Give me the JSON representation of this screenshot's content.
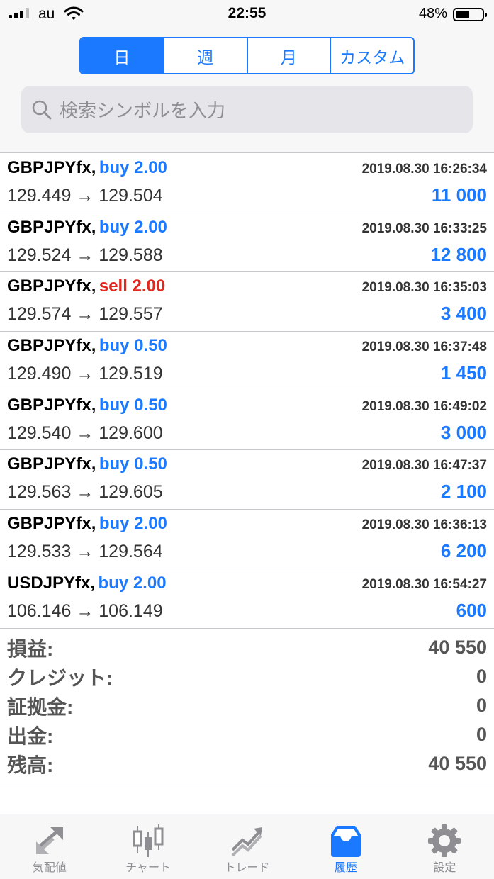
{
  "status_bar": {
    "carrier": "au",
    "time": "22:55",
    "battery": "48%"
  },
  "segments": [
    {
      "label": "日",
      "active": true
    },
    {
      "label": "週",
      "active": false
    },
    {
      "label": "月",
      "active": false
    },
    {
      "label": "カスタム",
      "active": false
    }
  ],
  "search": {
    "placeholder": "検索シンボルを入力"
  },
  "deals": [
    {
      "symbol": "GBPJPYfx,",
      "side": "buy 2.00",
      "type": "buy",
      "time": "2019.08.30 16:26:34",
      "prices": "129.449 → 129.504",
      "profit": "11 000"
    },
    {
      "symbol": "GBPJPYfx,",
      "side": "buy 2.00",
      "type": "buy",
      "time": "2019.08.30 16:33:25",
      "prices": "129.524 → 129.588",
      "profit": "12 800"
    },
    {
      "symbol": "GBPJPYfx,",
      "side": "sell 2.00",
      "type": "sell",
      "time": "2019.08.30 16:35:03",
      "prices": "129.574 → 129.557",
      "profit": "3 400"
    },
    {
      "symbol": "GBPJPYfx,",
      "side": "buy 0.50",
      "type": "buy",
      "time": "2019.08.30 16:37:48",
      "prices": "129.490 → 129.519",
      "profit": "1 450"
    },
    {
      "symbol": "GBPJPYfx,",
      "side": "buy 0.50",
      "type": "buy",
      "time": "2019.08.30 16:49:02",
      "prices": "129.540 → 129.600",
      "profit": "3 000"
    },
    {
      "symbol": "GBPJPYfx,",
      "side": "buy 0.50",
      "type": "buy",
      "time": "2019.08.30 16:47:37",
      "prices": "129.563 → 129.605",
      "profit": "2 100"
    },
    {
      "symbol": "GBPJPYfx,",
      "side": "buy 2.00",
      "type": "buy",
      "time": "2019.08.30 16:36:13",
      "prices": "129.533 → 129.564",
      "profit": "6 200"
    },
    {
      "symbol": "USDJPYfx,",
      "side": "buy 2.00",
      "type": "buy",
      "time": "2019.08.30 16:54:27",
      "prices": "106.146 → 106.149",
      "profit": "600"
    }
  ],
  "summary": [
    {
      "label": "損益:",
      "value": "40 550"
    },
    {
      "label": "クレジット:",
      "value": "0"
    },
    {
      "label": "証拠金:",
      "value": "0"
    },
    {
      "label": "出金:",
      "value": "0"
    },
    {
      "label": "残高:",
      "value": "40 550"
    }
  ],
  "tabs": [
    {
      "label": "気配値",
      "icon": "quotes-arrows-icon",
      "active": false
    },
    {
      "label": "チャート",
      "icon": "candlestick-icon",
      "active": false
    },
    {
      "label": "トレード",
      "icon": "trend-line-icon",
      "active": false
    },
    {
      "label": "履歴",
      "icon": "inbox-tray-icon",
      "active": true
    },
    {
      "label": "設定",
      "icon": "gear-icon",
      "active": false
    }
  ],
  "colors": {
    "accent": "#1a79ff",
    "sell": "#e0281f",
    "summary_text": "#555555"
  }
}
